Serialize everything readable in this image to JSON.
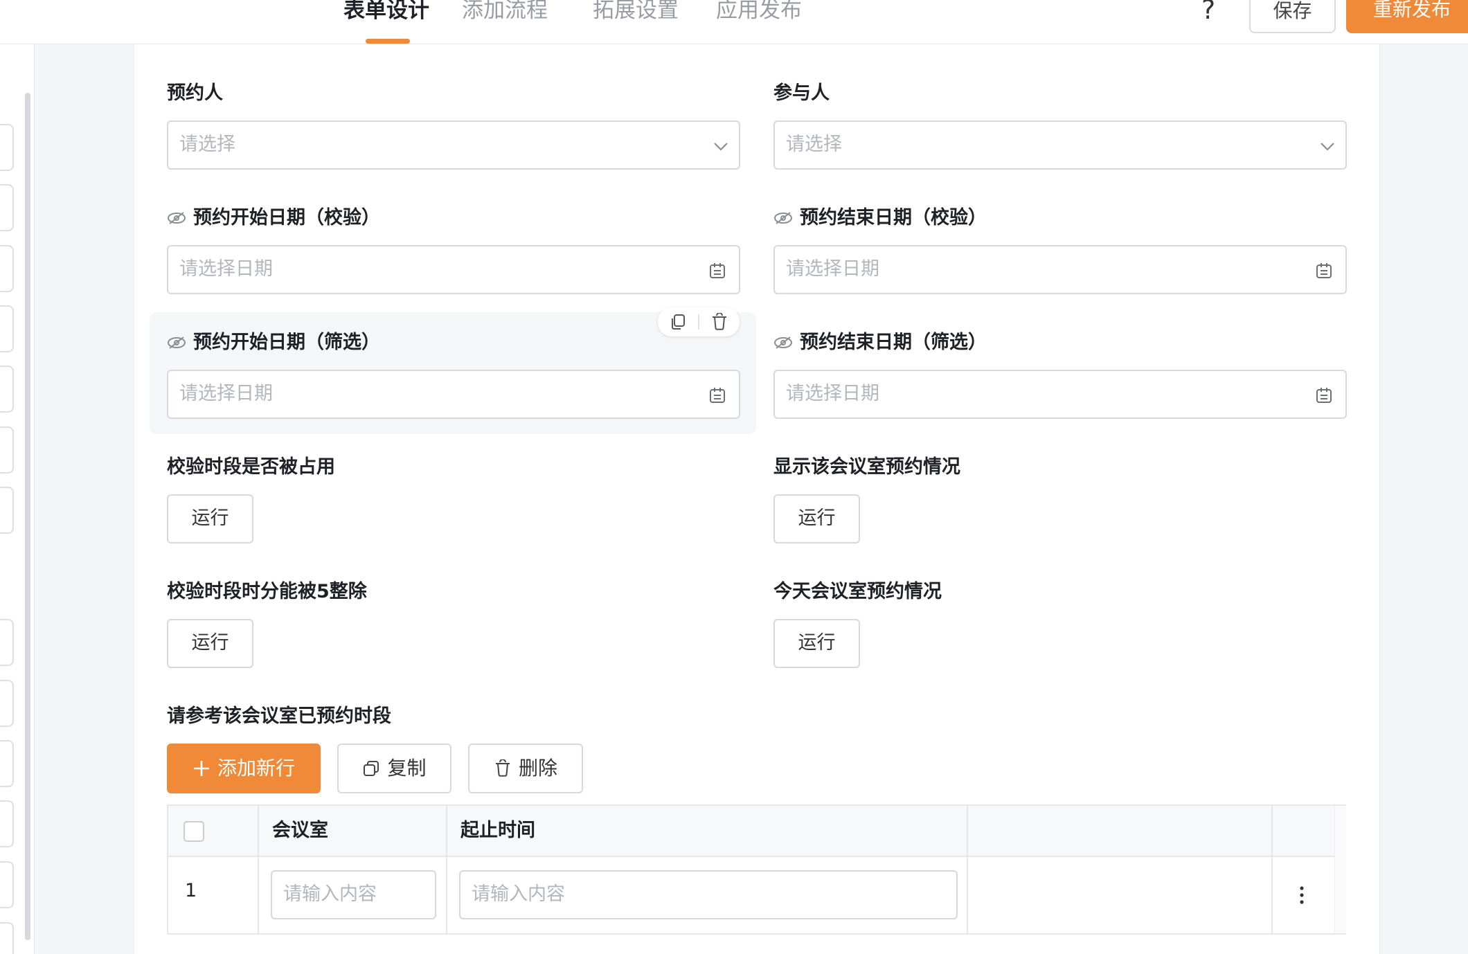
{
  "header": {
    "tabs": [
      {
        "label": "表单设计",
        "active": true
      },
      {
        "label": "添加流程",
        "active": false
      },
      {
        "label": "拓展设置",
        "active": false
      },
      {
        "label": "应用发布",
        "active": false
      }
    ],
    "help": "?",
    "save_label": "保存",
    "publish_label": "重新发布"
  },
  "form": {
    "booker": {
      "label": "预约人",
      "placeholder": "请选择"
    },
    "participants": {
      "label": "参与人",
      "placeholder": "请选择"
    },
    "start_date_check": {
      "label": "预约开始日期（校验）",
      "placeholder": "请选择日期"
    },
    "end_date_check": {
      "label": "预约结束日期（校验）",
      "placeholder": "请选择日期"
    },
    "start_date_filter": {
      "label": "预约开始日期（筛选）",
      "placeholder": "请选择日期"
    },
    "end_date_filter": {
      "label": "预约结束日期（筛选）",
      "placeholder": "请选择日期"
    },
    "check_occupied": {
      "label": "校验时段是否被占用",
      "button": "运行"
    },
    "show_room_bookings": {
      "label": "显示该会议室预约情况",
      "button": "运行"
    },
    "check_divisible": {
      "label": "校验时段时分能被5整除",
      "button": "运行"
    },
    "today_bookings": {
      "label": "今天会议室预约情况",
      "button": "运行"
    }
  },
  "subtable": {
    "label": "请参考该会议室已预约时段",
    "add_label": "添加新行",
    "copy_label": "复制",
    "delete_label": "删除",
    "columns": [
      "会议室",
      "起止时间"
    ],
    "rows": [
      {
        "index": "1",
        "room_placeholder": "请输入内容",
        "time_placeholder": "请输入内容"
      }
    ]
  },
  "colors": {
    "accent": "#f08a39",
    "border": "#d6d9df",
    "placeholder": "#b3b6bc"
  },
  "icons": [
    "chevron-down-icon",
    "calendar-icon",
    "eye-off-icon",
    "copy-icon",
    "trash-icon",
    "plus-icon",
    "more-vertical-icon"
  ]
}
